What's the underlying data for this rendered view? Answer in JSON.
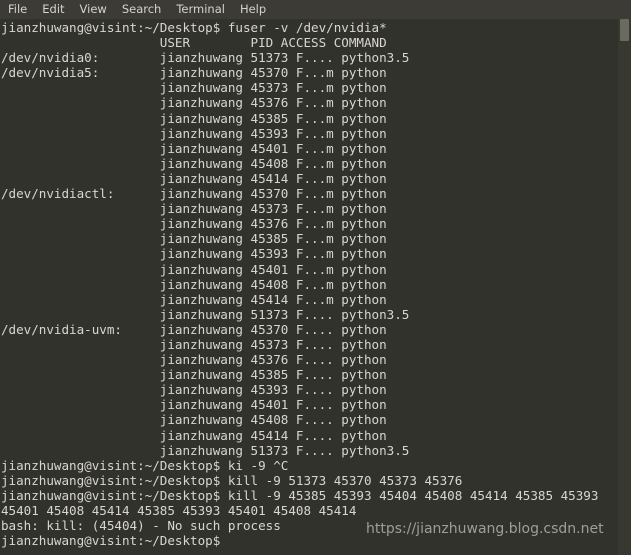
{
  "window": {
    "title": "Terminal",
    "background_color": "#32322c",
    "menubar_color": "#3c3b35",
    "text_color": "#d8d6ce"
  },
  "menu": {
    "items": [
      {
        "label": "File"
      },
      {
        "label": "Edit"
      },
      {
        "label": "View"
      },
      {
        "label": "Search"
      },
      {
        "label": "Terminal"
      },
      {
        "label": "Help"
      }
    ]
  },
  "watermark": {
    "text": "https://jianzhuwang.blog.csdn.net",
    "color": "#a9a79e"
  },
  "terminal": {
    "prompt": "jianzhuwang@visint:~/Desktop$",
    "lines": [
      "jianzhuwang@visint:~/Desktop$ fuser -v /dev/nvidia*",
      "                     USER        PID ACCESS COMMAND",
      "/dev/nvidia0:        jianzhuwang 51373 F.... python3.5",
      "/dev/nvidia5:        jianzhuwang 45370 F...m python",
      "                     jianzhuwang 45373 F...m python",
      "                     jianzhuwang 45376 F...m python",
      "                     jianzhuwang 45385 F...m python",
      "                     jianzhuwang 45393 F...m python",
      "                     jianzhuwang 45401 F...m python",
      "                     jianzhuwang 45408 F...m python",
      "                     jianzhuwang 45414 F...m python",
      "/dev/nvidiactl:      jianzhuwang 45370 F...m python",
      "                     jianzhuwang 45373 F...m python",
      "                     jianzhuwang 45376 F...m python",
      "                     jianzhuwang 45385 F...m python",
      "                     jianzhuwang 45393 F...m python",
      "                     jianzhuwang 45401 F...m python",
      "                     jianzhuwang 45408 F...m python",
      "                     jianzhuwang 45414 F...m python",
      "                     jianzhuwang 51373 F.... python3.5",
      "/dev/nvidia-uvm:     jianzhuwang 45370 F.... python",
      "                     jianzhuwang 45373 F.... python",
      "                     jianzhuwang 45376 F.... python",
      "                     jianzhuwang 45385 F.... python",
      "                     jianzhuwang 45393 F.... python",
      "                     jianzhuwang 45401 F.... python",
      "                     jianzhuwang 45408 F.... python",
      "                     jianzhuwang 45414 F.... python",
      "                     jianzhuwang 51373 F.... python3.5",
      "jianzhuwang@visint:~/Desktop$ ki -9 ^C",
      "jianzhuwang@visint:~/Desktop$ kill -9 51373 45370 45373 45376",
      "jianzhuwang@visint:~/Desktop$ kill -9 45385 45393 45404 45408 45414 45385 45393",
      "45401 45408 45414 45385 45393 45401 45408 45414",
      "bash: kill: (45404) - No such process",
      "jianzhuwang@visint:~/Desktop$"
    ],
    "command_history": [
      "fuser -v /dev/nvidia*",
      "ki -9 ^C",
      "kill -9 51373 45370 45373 45376",
      "kill -9 45385 45393 45404 45408 45414 45385 45393 45401 45408 45414 45385 45393 45401 45408 45414"
    ],
    "error_message": "bash: kill: (45404) - No such process",
    "table_headers": [
      "USER",
      "PID",
      "ACCESS",
      "COMMAND"
    ],
    "devices": [
      {
        "name": "/dev/nvidia0:",
        "processes": [
          {
            "user": "jianzhuwang",
            "pid": "51373",
            "access": "F....",
            "command": "python3.5"
          }
        ]
      },
      {
        "name": "/dev/nvidia5:",
        "processes": [
          {
            "user": "jianzhuwang",
            "pid": "45370",
            "access": "F...m",
            "command": "python"
          },
          {
            "user": "jianzhuwang",
            "pid": "45373",
            "access": "F...m",
            "command": "python"
          },
          {
            "user": "jianzhuwang",
            "pid": "45376",
            "access": "F...m",
            "command": "python"
          },
          {
            "user": "jianzhuwang",
            "pid": "45385",
            "access": "F...m",
            "command": "python"
          },
          {
            "user": "jianzhuwang",
            "pid": "45393",
            "access": "F...m",
            "command": "python"
          },
          {
            "user": "jianzhuwang",
            "pid": "45401",
            "access": "F...m",
            "command": "python"
          },
          {
            "user": "jianzhuwang",
            "pid": "45408",
            "access": "F...m",
            "command": "python"
          },
          {
            "user": "jianzhuwang",
            "pid": "45414",
            "access": "F...m",
            "command": "python"
          }
        ]
      },
      {
        "name": "/dev/nvidiactl:",
        "processes": [
          {
            "user": "jianzhuwang",
            "pid": "45370",
            "access": "F...m",
            "command": "python"
          },
          {
            "user": "jianzhuwang",
            "pid": "45373",
            "access": "F...m",
            "command": "python"
          },
          {
            "user": "jianzhuwang",
            "pid": "45376",
            "access": "F...m",
            "command": "python"
          },
          {
            "user": "jianzhuwang",
            "pid": "45385",
            "access": "F...m",
            "command": "python"
          },
          {
            "user": "jianzhuwang",
            "pid": "45393",
            "access": "F...m",
            "command": "python"
          },
          {
            "user": "jianzhuwang",
            "pid": "45401",
            "access": "F...m",
            "command": "python"
          },
          {
            "user": "jianzhuwang",
            "pid": "45408",
            "access": "F...m",
            "command": "python"
          },
          {
            "user": "jianzhuwang",
            "pid": "45414",
            "access": "F...m",
            "command": "python"
          },
          {
            "user": "jianzhuwang",
            "pid": "51373",
            "access": "F....",
            "command": "python3.5"
          }
        ]
      },
      {
        "name": "/dev/nvidia-uvm:",
        "processes": [
          {
            "user": "jianzhuwang",
            "pid": "45370",
            "access": "F....",
            "command": "python"
          },
          {
            "user": "jianzhuwang",
            "pid": "45373",
            "access": "F....",
            "command": "python"
          },
          {
            "user": "jianzhuwang",
            "pid": "45376",
            "access": "F....",
            "command": "python"
          },
          {
            "user": "jianzhuwang",
            "pid": "45385",
            "access": "F....",
            "command": "python"
          },
          {
            "user": "jianzhuwang",
            "pid": "45393",
            "access": "F....",
            "command": "python"
          },
          {
            "user": "jianzhuwang",
            "pid": "45401",
            "access": "F....",
            "command": "python"
          },
          {
            "user": "jianzhuwang",
            "pid": "45408",
            "access": "F....",
            "command": "python"
          },
          {
            "user": "jianzhuwang",
            "pid": "45414",
            "access": "F....",
            "command": "python"
          },
          {
            "user": "jianzhuwang",
            "pid": "51373",
            "access": "F....",
            "command": "python3.5"
          }
        ]
      }
    ]
  }
}
